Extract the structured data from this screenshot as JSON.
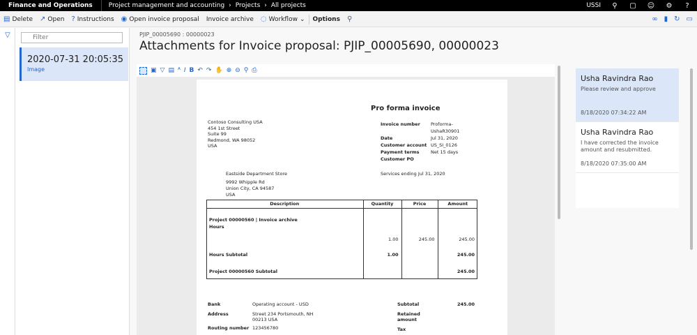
{
  "topbar": {
    "app": "Finance and Operations",
    "crumbs": [
      "Project management and accounting",
      "Projects",
      "All projects"
    ],
    "company": "USSI",
    "help": "?"
  },
  "actions": {
    "delete": "Delete",
    "open": "Open",
    "instructions": "Instructions",
    "open_proposal": "Open invoice proposal",
    "invoice_archive": "Invoice archive",
    "workflow": "Workflow",
    "options": "Options"
  },
  "list": {
    "filter_placeholder": "Filter",
    "items": [
      {
        "date": "2020-07-31 20:05:35",
        "type": "Image"
      }
    ]
  },
  "main": {
    "subtitle": "PJIP_00005690 : 00000023",
    "title": "Attachments for Invoice proposal: PJIP_00005690, 00000023"
  },
  "invoice": {
    "heading": "Pro forma invoice",
    "from": [
      "Contoso Consulting USA",
      "454 1st Street",
      "Suite 99",
      "Redmond, WA 98052",
      "USA"
    ],
    "to": [
      "Eastside Department Store",
      "9992 Whipple Rd",
      "Union City, CA 94587",
      "USA"
    ],
    "meta": [
      {
        "k": "Invoice number",
        "v": "Proforma-"
      },
      {
        "k": "",
        "v": "UshaR30901"
      },
      {
        "k": "Date",
        "v": "Jul 31, 2020"
      },
      {
        "k": "Customer account",
        "v": "US_SI_0126"
      },
      {
        "k": "Payment terms",
        "v": "Net 15 days"
      },
      {
        "k": "Customer PO",
        "v": ""
      }
    ],
    "services": "Services ending Jul 31, 2020",
    "columns": [
      "Description",
      "Quantity",
      "Price",
      "Amount"
    ],
    "project_line": "Project 00000560 | Invoice archive",
    "hours_label": "Hours",
    "hours_row": {
      "qty": "1.00",
      "price": "245.00",
      "amount": "245.00"
    },
    "hours_subtotal_label": "Hours Subtotal",
    "hours_subtotal": {
      "qty": "1.00",
      "amount": "245.00"
    },
    "project_subtotal_label": "Project 00000560 Subtotal",
    "project_subtotal": "245.00",
    "bank_label": "Bank",
    "bank_value": "Operating account - USD",
    "address_label": "Address",
    "address_value": [
      "Street 234 Portsmouth, NH",
      "00213 USA"
    ],
    "routing_label": "Routing number",
    "routing_value": "123456780",
    "subtotal_label": "Subtotal",
    "subtotal_value": "245.00",
    "retained_label": [
      "Retained",
      "amount"
    ],
    "tax_label": "Tax"
  },
  "notes": [
    {
      "name": "Usha Ravindra Rao",
      "text": "Please review and approve",
      "time": "8/18/2020 07:34:22 AM"
    },
    {
      "name": "Usha Ravindra Rao",
      "text": "I have corrected the invoice amount and resubmitted.",
      "time": "8/18/2020 07:35:00 AM"
    }
  ]
}
